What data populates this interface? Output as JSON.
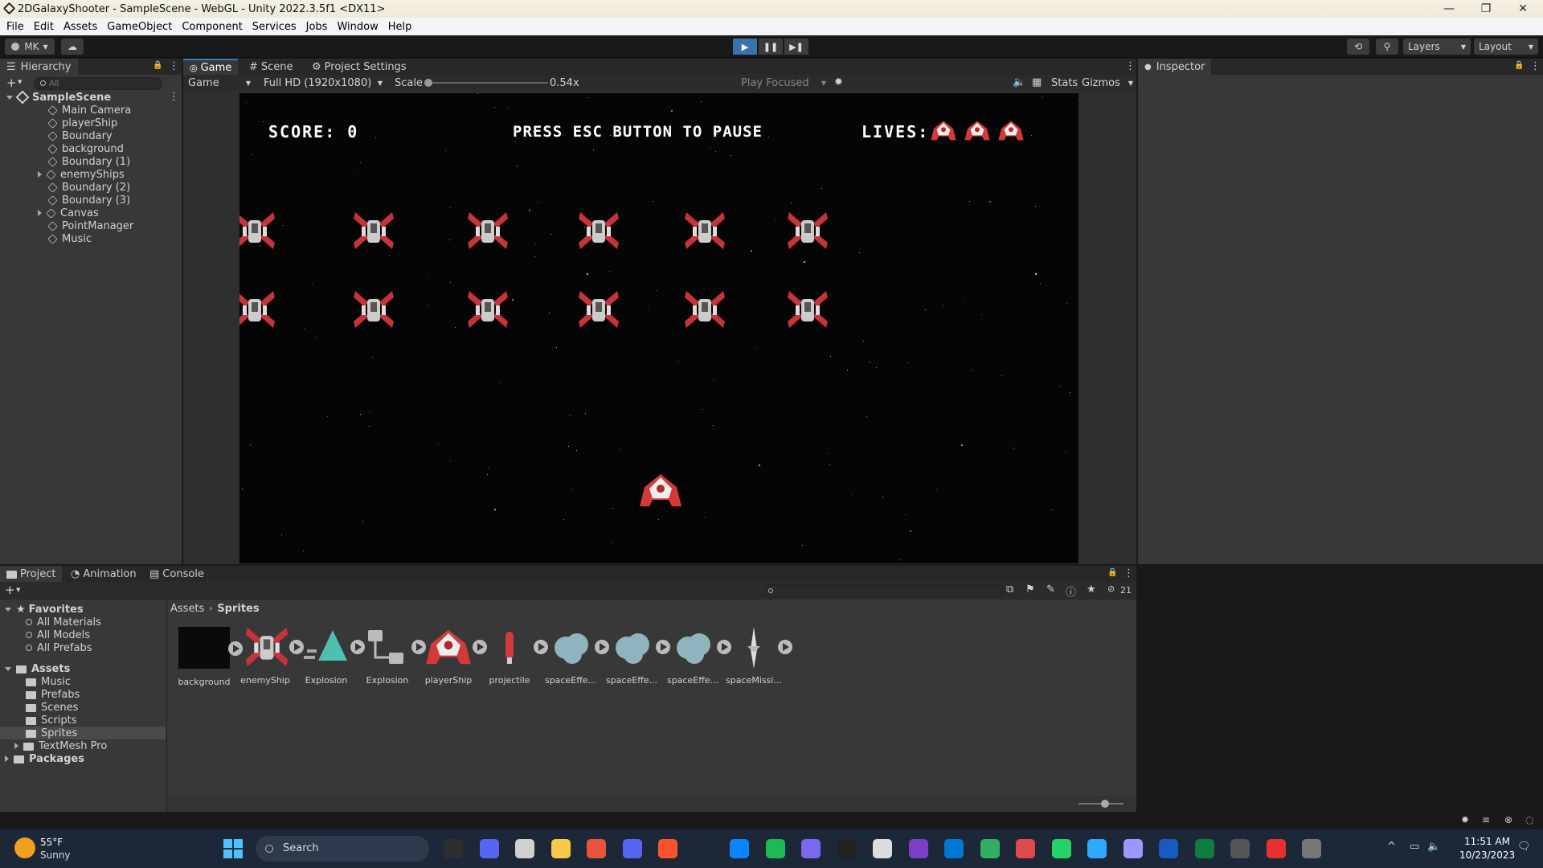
{
  "window": {
    "title": "2DGalaxyShooter - SampleScene - WebGL - Unity 2022.3.5f1 <DX11>",
    "minimize": "—",
    "restore": "❐",
    "close": "✕"
  },
  "menu": [
    "File",
    "Edit",
    "Assets",
    "GameObject",
    "Component",
    "Services",
    "Jobs",
    "Window",
    "Help"
  ],
  "toolbar": {
    "account": "MK",
    "layers": "Layers",
    "layout": "Layout"
  },
  "hierarchy": {
    "tab": "Hierarchy",
    "search_placeholder": "All",
    "scene": "SampleScene",
    "items": [
      {
        "label": "Main Camera",
        "expandable": false
      },
      {
        "label": "playerShip",
        "expandable": false
      },
      {
        "label": "Boundary",
        "expandable": false
      },
      {
        "label": "background",
        "expandable": false
      },
      {
        "label": "Boundary (1)",
        "expandable": false
      },
      {
        "label": "enemyShips",
        "expandable": true
      },
      {
        "label": "Boundary (2)",
        "expandable": false
      },
      {
        "label": "Boundary (3)",
        "expandable": false
      },
      {
        "label": "Canvas",
        "expandable": true
      },
      {
        "label": "PointManager",
        "expandable": false
      },
      {
        "label": "Music",
        "expandable": false
      }
    ]
  },
  "center_tabs": {
    "game": "Game",
    "scene": "Scene",
    "project_settings": "Project Settings"
  },
  "game_toolbar": {
    "display": "Game",
    "resolution": "Full HD (1920x1080)",
    "scale_label": "Scale",
    "scale_value": "0.54x",
    "play_mode": "Play Focused",
    "stats": "Stats",
    "gizmos": "Gizmos"
  },
  "game_hud": {
    "score": "SCORE: 0",
    "pause": "PRESS ESC BUTTON TO PAUSE",
    "lives_label": "LIVES:",
    "lives": 3
  },
  "inspector": {
    "tab": "Inspector"
  },
  "bottom_tabs": {
    "project": "Project",
    "animation": "Animation",
    "console": "Console",
    "hidden_count": "21"
  },
  "project_tree": {
    "favorites": "Favorites",
    "favorite_items": [
      "All Materials",
      "All Models",
      "All Prefabs"
    ],
    "assets": "Assets",
    "asset_folders": [
      "Music",
      "Prefabs",
      "Scenes",
      "Scripts",
      "Sprites",
      "TextMesh Pro"
    ],
    "packages": "Packages"
  },
  "breadcrumb": {
    "root": "Assets",
    "current": "Sprites"
  },
  "assets_grid": [
    {
      "label": "background",
      "kind": "background"
    },
    {
      "label": "enemyShip",
      "kind": "enemy"
    },
    {
      "label": "Explosion",
      "kind": "anim"
    },
    {
      "label": "Explosion",
      "kind": "controller"
    },
    {
      "label": "playerShip",
      "kind": "player"
    },
    {
      "label": "projectile",
      "kind": "projectile"
    },
    {
      "label": "spaceEffe...",
      "kind": "cloud"
    },
    {
      "label": "spaceEffe...",
      "kind": "cloud"
    },
    {
      "label": "spaceEffe...",
      "kind": "cloud"
    },
    {
      "label": "spaceMissi...",
      "kind": "missile"
    }
  ],
  "taskbar": {
    "weather_temp": "55°F",
    "weather_desc": "Sunny",
    "search": "Search",
    "time": "11:51 AM",
    "date": "10/23/2023"
  },
  "colors": {
    "accent": "#3a79bb",
    "enemy_red": "#c8323a",
    "panel": "#383838"
  }
}
